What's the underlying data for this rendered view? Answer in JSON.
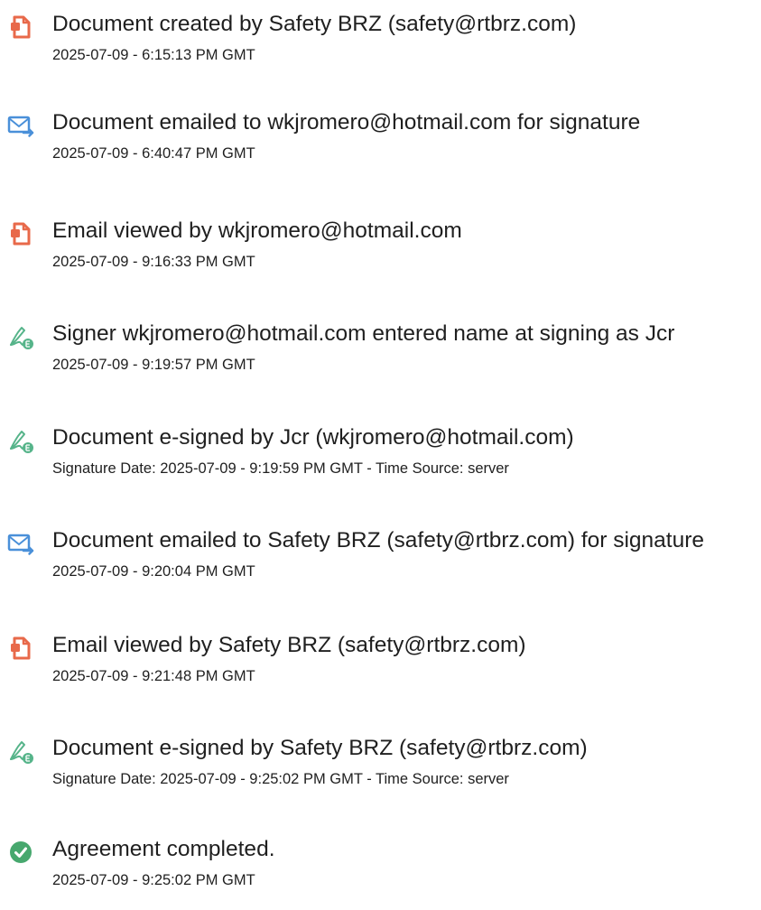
{
  "events": [
    {
      "icon": "document-created-icon",
      "title": "Document created by Safety BRZ (safety@rtbrz.com)",
      "time": "2025-07-09 - 6:15:13 PM GMT"
    },
    {
      "icon": "email-sent-icon",
      "title": "Document emailed to wkjromero@hotmail.com for signature",
      "time": "2025-07-09 - 6:40:47 PM GMT"
    },
    {
      "icon": "document-viewed-icon",
      "title": "Email viewed by wkjromero@hotmail.com",
      "time": "2025-07-09 - 9:16:33 PM GMT"
    },
    {
      "icon": "e-signature-icon",
      "title": "Signer wkjromero@hotmail.com entered name at signing as Jcr",
      "time": "2025-07-09 - 9:19:57 PM GMT"
    },
    {
      "icon": "e-signature-icon",
      "title": "Document e-signed by Jcr (wkjromero@hotmail.com)",
      "time": "Signature Date: 2025-07-09 - 9:19:59 PM GMT - Time Source: server"
    },
    {
      "icon": "email-sent-icon",
      "title": "Document emailed to Safety BRZ (safety@rtbrz.com) for signature",
      "time": "2025-07-09 - 9:20:04 PM GMT"
    },
    {
      "icon": "document-viewed-icon",
      "title": "Email viewed by Safety BRZ (safety@rtbrz.com)",
      "time": "2025-07-09 - 9:21:48 PM GMT"
    },
    {
      "icon": "e-signature-icon",
      "title": "Document e-signed by Safety BRZ (safety@rtbrz.com)",
      "time": "Signature Date: 2025-07-09 - 9:25:02 PM GMT - Time Source: server"
    },
    {
      "icon": "agreement-completed-icon",
      "title": "Agreement completed.",
      "time": "2025-07-09 - 9:25:02 PM GMT"
    }
  ],
  "colors": {
    "document_icon": "#e8694a",
    "email_icon": "#4a90d9",
    "signature_icon": "#56b48a",
    "completed_icon": "#47a86e",
    "text": "#1f1f1f"
  }
}
